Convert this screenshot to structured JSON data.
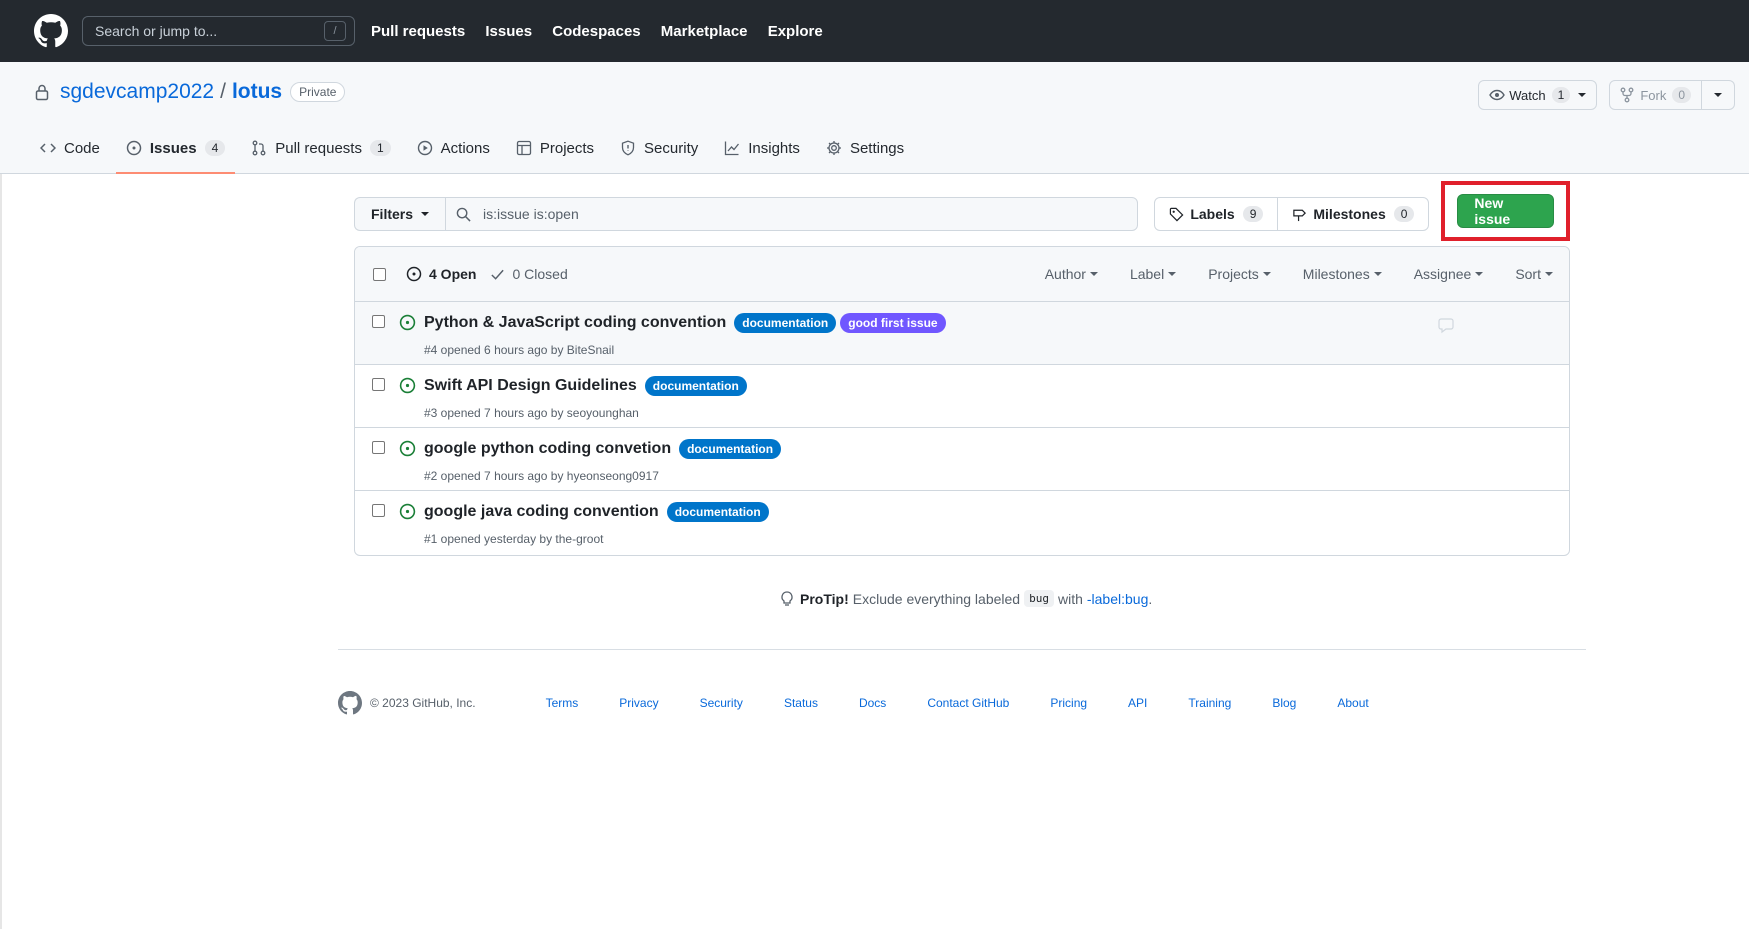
{
  "header": {
    "search_placeholder": "Search or jump to...",
    "search_shortcut": "/",
    "nav": [
      "Pull requests",
      "Issues",
      "Codespaces",
      "Marketplace",
      "Explore"
    ]
  },
  "repo": {
    "owner": "sgdevcamp2022",
    "separator": "/",
    "name": "lotus",
    "visibility": "Private",
    "watch_label": "Watch",
    "watch_count": "1",
    "fork_label": "Fork",
    "fork_count": "0",
    "tabs": [
      {
        "label": "Code",
        "icon": "code-icon"
      },
      {
        "label": "Issues",
        "count": "4",
        "icon": "issue-opened-icon",
        "selected": true
      },
      {
        "label": "Pull requests",
        "count": "1",
        "icon": "git-pull-request-icon"
      },
      {
        "label": "Actions",
        "icon": "play-icon"
      },
      {
        "label": "Projects",
        "icon": "table-icon"
      },
      {
        "label": "Security",
        "icon": "shield-icon"
      },
      {
        "label": "Insights",
        "icon": "graph-icon"
      },
      {
        "label": "Settings",
        "icon": "gear-icon"
      }
    ]
  },
  "toolbar": {
    "filters_label": "Filters",
    "query": "is:issue is:open",
    "labels_label": "Labels",
    "labels_count": "9",
    "milestones_label": "Milestones",
    "milestones_count": "0",
    "new_issue_label": "New issue"
  },
  "issues_header": {
    "open_label": "4 Open",
    "closed_label": "0 Closed",
    "sorters": [
      "Author",
      "Label",
      "Projects",
      "Milestones",
      "Assignee",
      "Sort"
    ]
  },
  "issues": [
    {
      "title": "Python & JavaScript coding convention",
      "labels": [
        "documentation",
        "good first issue"
      ],
      "meta": "#4 opened 6 hours ago by BiteSnail"
    },
    {
      "title": "Swift API Design Guidelines",
      "labels": [
        "documentation"
      ],
      "meta": "#3 opened 7 hours ago by seoyounghan"
    },
    {
      "title": "google python coding convetion",
      "labels": [
        "documentation"
      ],
      "meta": "#2 opened 7 hours ago by hyeonseong0917"
    },
    {
      "title": "google java coding convention",
      "labels": [
        "documentation"
      ],
      "meta": "#1 opened yesterday by the-groot"
    }
  ],
  "label_colors": {
    "documentation": "#0075ca",
    "good first issue": "#7057ff"
  },
  "colors": {
    "accent_green": "#2da44e",
    "tab_underline": "#fd8c73",
    "highlight_box": "#e0202b",
    "link": "#0969da"
  },
  "protip": {
    "title": "ProTip!",
    "text": "Exclude everything labeled",
    "code": "bug",
    "with": "with",
    "link": "-label:bug",
    "end": "."
  },
  "footer": {
    "copyright": "© 2023 GitHub, Inc.",
    "links": [
      "Terms",
      "Privacy",
      "Security",
      "Status",
      "Docs",
      "Contact GitHub",
      "Pricing",
      "API",
      "Training",
      "Blog",
      "About"
    ]
  }
}
